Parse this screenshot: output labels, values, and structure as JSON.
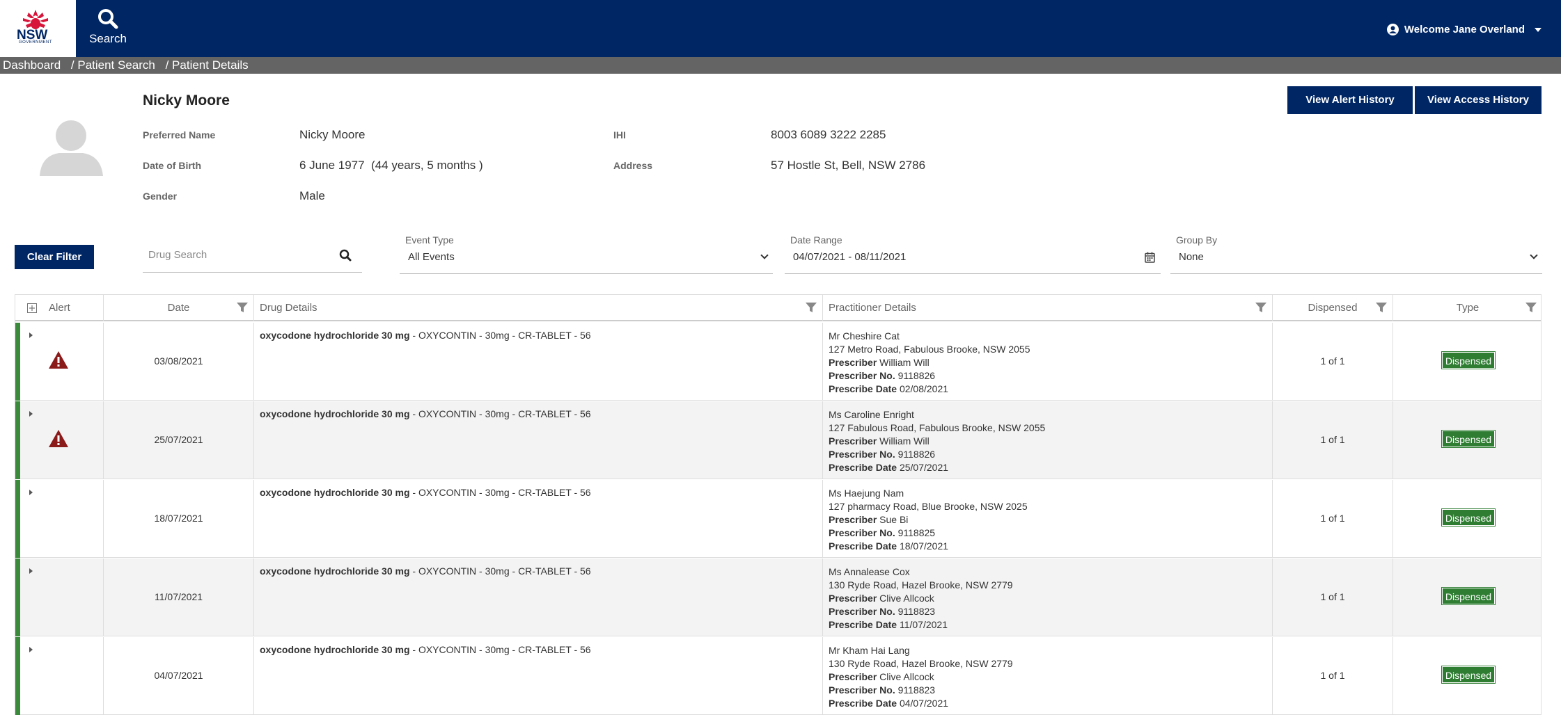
{
  "header": {
    "logo_text": "NSW",
    "logo_subtext": "GOVERNMENT",
    "nav_search_label": "Search",
    "welcome": "Welcome Jane Overland"
  },
  "breadcrumb": [
    "Dashboard",
    "/ Patient Search",
    "/ Patient Details"
  ],
  "patient": {
    "name": "Nicky Moore",
    "preferred_name_label": "Preferred Name",
    "preferred_name": "Nicky Moore",
    "dob_label": "Date of Birth",
    "dob": "6 June 1977  (44 years, 5 months )",
    "gender_label": "Gender",
    "gender": "Male",
    "ihi_label": "IHI",
    "ihi": "8003 6089 3222 2285",
    "address_label": "Address",
    "address": "57 Hostle St, Bell, NSW 2786"
  },
  "actions": {
    "alert_history": "View Alert History",
    "access_history": "View Access History",
    "clear_filter": "Clear Filter"
  },
  "filters": {
    "drug_search_placeholder": "Drug Search",
    "event_type_label": "Event Type",
    "event_type_value": "All Events",
    "date_range_label": "Date Range",
    "date_range_value": "04/07/2021 - 08/11/2021",
    "group_by_label": "Group By",
    "group_by_value": "None"
  },
  "table": {
    "columns": [
      "Alert",
      "Date",
      "Drug Details",
      "Practitioner Details",
      "Dispensed",
      "Type"
    ],
    "rows": [
      {
        "alert": true,
        "date": "03/08/2021",
        "drug_name": "oxycodone hydrochloride 30 mg",
        "drug_desc": " - OXYCONTIN - 30mg - CR-TABLET - 56",
        "prac_name": "Mr Cheshire Cat",
        "prac_address": "127 Metro Road, Fabulous Brooke, NSW 2055",
        "prescriber_label": "Prescriber",
        "prescriber": "William Will",
        "prescriber_no_label": "Prescriber No.",
        "prescriber_no": "9118826",
        "prescribe_date_label": "Prescribe Date",
        "prescribe_date": "02/08/2021",
        "dispensed": "1 of 1",
        "type": "Dispensed"
      },
      {
        "alert": true,
        "date": "25/07/2021",
        "drug_name": "oxycodone hydrochloride 30 mg",
        "drug_desc": " - OXYCONTIN - 30mg - CR-TABLET - 56",
        "prac_name": "Ms Caroline Enright",
        "prac_address": "127 Fabulous Road, Fabulous Brooke, NSW 2055",
        "prescriber_label": "Prescriber",
        "prescriber": "William Will",
        "prescriber_no_label": "Prescriber No.",
        "prescriber_no": "9118826",
        "prescribe_date_label": "Prescribe Date",
        "prescribe_date": "25/07/2021",
        "dispensed": "1 of 1",
        "type": "Dispensed"
      },
      {
        "alert": false,
        "date": "18/07/2021",
        "drug_name": "oxycodone hydrochloride 30 mg",
        "drug_desc": " - OXYCONTIN - 30mg - CR-TABLET - 56",
        "prac_name": "Ms Haejung Nam",
        "prac_address": "127 pharmacy Road, Blue Brooke, NSW 2025",
        "prescriber_label": "Prescriber",
        "prescriber": "Sue Bi",
        "prescriber_no_label": "Prescriber No.",
        "prescriber_no": "9118825",
        "prescribe_date_label": "Prescribe Date",
        "prescribe_date": "18/07/2021",
        "dispensed": "1 of 1",
        "type": "Dispensed"
      },
      {
        "alert": false,
        "date": "11/07/2021",
        "drug_name": "oxycodone hydrochloride 30 mg",
        "drug_desc": " - OXYCONTIN - 30mg - CR-TABLET - 56",
        "prac_name": "Ms Annalease Cox",
        "prac_address": "130 Ryde Road, Hazel Brooke, NSW 2779",
        "prescriber_label": "Prescriber",
        "prescriber": "Clive Allcock",
        "prescriber_no_label": "Prescriber No.",
        "prescriber_no": "9118823",
        "prescribe_date_label": "Prescribe Date",
        "prescribe_date": "11/07/2021",
        "dispensed": "1 of 1",
        "type": "Dispensed"
      },
      {
        "alert": false,
        "date": "04/07/2021",
        "drug_name": "oxycodone hydrochloride 30 mg",
        "drug_desc": " - OXYCONTIN - 30mg - CR-TABLET - 56",
        "prac_name": "Mr Kham Hai Lang",
        "prac_address": "130 Ryde Road, Hazel Brooke, NSW 2779",
        "prescriber_label": "Prescriber",
        "prescriber": "Clive Allcock",
        "prescriber_no_label": "Prescriber No.",
        "prescriber_no": "9118823",
        "prescribe_date_label": "Prescribe Date",
        "prescribe_date": "04/07/2021",
        "dispensed": "1 of 1",
        "type": "Dispensed"
      }
    ]
  },
  "colors": {
    "nav": "#002664",
    "breadcrumb": "#646464",
    "dispensed_badge": "#2e7d32",
    "row_bar": "#3b8a3b",
    "alert_icon": "#8b1a1a"
  },
  "icons": {
    "nav_search": "search-icon",
    "user": "user-circle-icon",
    "alert": "warning-triangle-icon",
    "filter": "funnel-icon",
    "calendar": "calendar-icon",
    "expand_all": "expand-all-icon"
  }
}
